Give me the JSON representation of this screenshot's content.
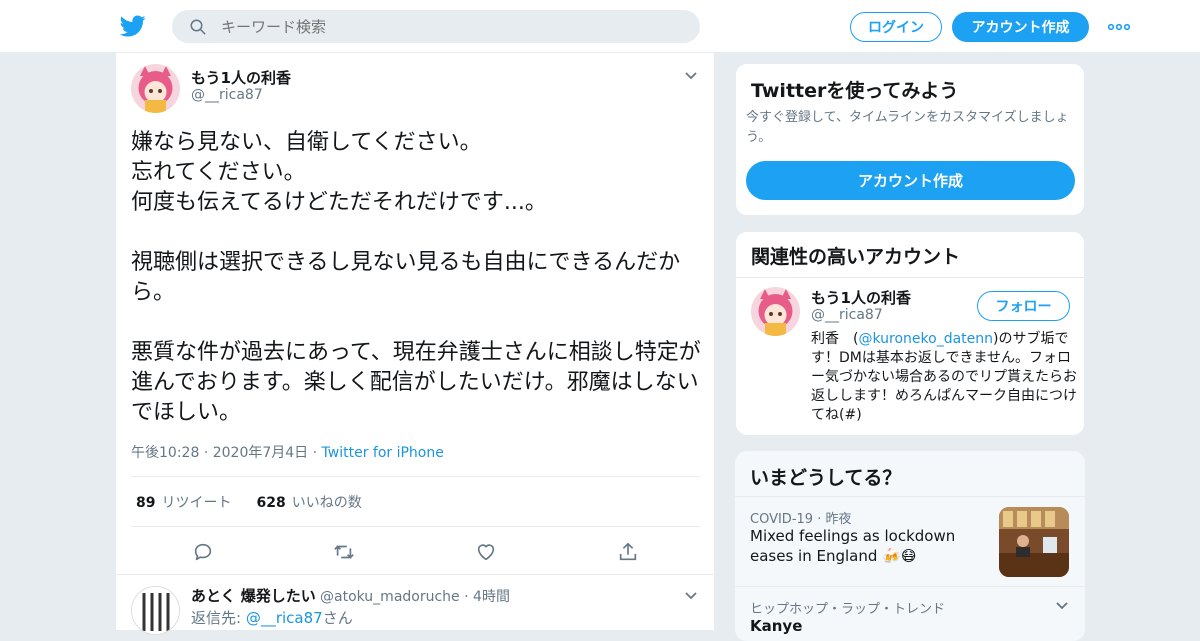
{
  "header": {
    "search_placeholder": "キーワード検索",
    "login_label": "ログイン",
    "signup_label": "アカウント作成"
  },
  "tweet": {
    "display_name": "もう1人の利香",
    "handle": "@__rica87",
    "text": "嫌なら見ない、自衛してください。\n忘れてください。\n何度も伝えてるけどただそれだけです...。\n\n視聴側は選択できるし見ない見るも自由にできるんだから。\n\n悪質な件が過去にあって、現在弁護士さんに相談し特定が進んでおります。楽しく配信がしたいだけ。邪魔はしないでほしい。",
    "time": "午後10:28",
    "date": "2020年7月4日",
    "source": "Twitter for iPhone",
    "retweet_count": "89",
    "retweet_label": "リツイート",
    "like_count": "628",
    "like_label": "いいねの数"
  },
  "reply": {
    "display_name": "あとく 爆発したい",
    "handle": "@atoku_madoruche",
    "time": "4時間",
    "reply_prefix": "返信先:",
    "reply_to": "@__rica87",
    "reply_suffix": "さん"
  },
  "signup_card": {
    "title": "Twitterを使ってみよう",
    "desc": "今すぐ登録して、タイムラインをカスタマイズしましょう。",
    "button": "アカウント作成"
  },
  "related_card": {
    "title": "関連性の高いアカウント",
    "display_name": "もう1人の利香",
    "handle": "@__rica87",
    "follow_label": "フォロー",
    "bio_pre": "利香　(",
    "bio_link": "@kuroneko_datenn",
    "bio_post": ")のサブ垢です！DMは基本お返しできません。フォロー気づかない場合あるのでリプ貰えたらお返しします！めろんぱんマーク自由につけてね(#)"
  },
  "trends_card": {
    "title": "いまどうしてる？",
    "trend1_category": "COVID-19",
    "trend1_time": "昨夜",
    "trend1_title": "Mixed feelings as lockdown eases in England 🍻😷",
    "trend2_meta": "ヒップホップ・ラップ・トレンド",
    "trend2_title": "Kanye"
  },
  "colors": {
    "accent": "#1da1f2",
    "link": "#1b95e0",
    "background": "#e6ecf0",
    "muted": "#657786"
  }
}
